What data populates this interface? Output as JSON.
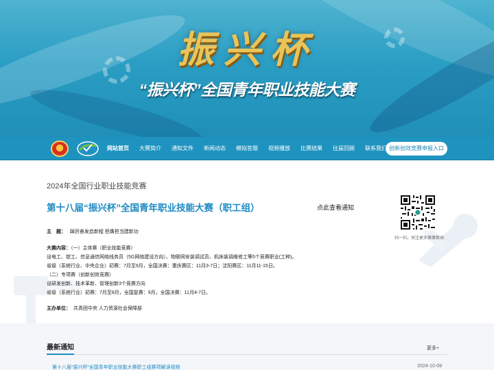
{
  "banner": {
    "logo_text": "振兴杯",
    "title": "“振兴杯”全国青年职业技能大赛"
  },
  "nav": {
    "items": [
      {
        "label": "网站首页",
        "active": true
      },
      {
        "label": "大赛简介"
      },
      {
        "label": "通知文件"
      },
      {
        "label": "新闻动态"
      },
      {
        "label": "模拟答题"
      },
      {
        "label": "视频播放"
      },
      {
        "label": "比赛结果"
      },
      {
        "label": "往届回顾"
      },
      {
        "label": "联系我们"
      }
    ],
    "apply_button": "创新创效竞赛申报入口"
  },
  "main": {
    "year_title": "2024年全国行业职业技能竞赛",
    "title": "第十八届“振兴杯”全国青年职业技能大赛（职工组）",
    "notice_link": "点此查看通知",
    "theme_label": "主　题：",
    "theme_value": "踔厉奋发启新程 担膺担当建新功",
    "content_label": "大赛内容：",
    "content_lines": [
      "（一）主体赛（职业技能竞赛）",
      "设电工、钳工、信息通信网络线务员（5G网络建设方向）、物联网安装调试员、机床装调维修工等5个竞赛职业(工种)。",
      "省级（系统行业、中央企业）初赛：7月至9月，全国决赛：重庆赛区：11月3-7日；沈阳赛区：11月11-15日。",
      "（二）专项赛（创新创效竞赛）",
      "设研发创新、技术革新、管理创新3个竞赛方向",
      "省级（系统行业）初赛：7月至8月，全国复赛：9月，全国决赛：11月4-7日。"
    ],
    "organizer_label": "主办单位：",
    "organizer_value": "共青团中央 人力资源社会保障部",
    "qr_caption": "扫一扫，关注更多赛事新闻"
  },
  "news": {
    "title": "最新通知",
    "more": "更多+",
    "items": [
      {
        "title": "第十八届“振兴杯”全国青年职业技能大赛职工组赛项解读视频",
        "date": "2024-10-09"
      }
    ]
  },
  "colors": {
    "primary": "#1e8bc3",
    "nav_bg": "#1f93bf",
    "banner_top": "#4fb3d0",
    "logo_gold": "#e8c45a"
  }
}
